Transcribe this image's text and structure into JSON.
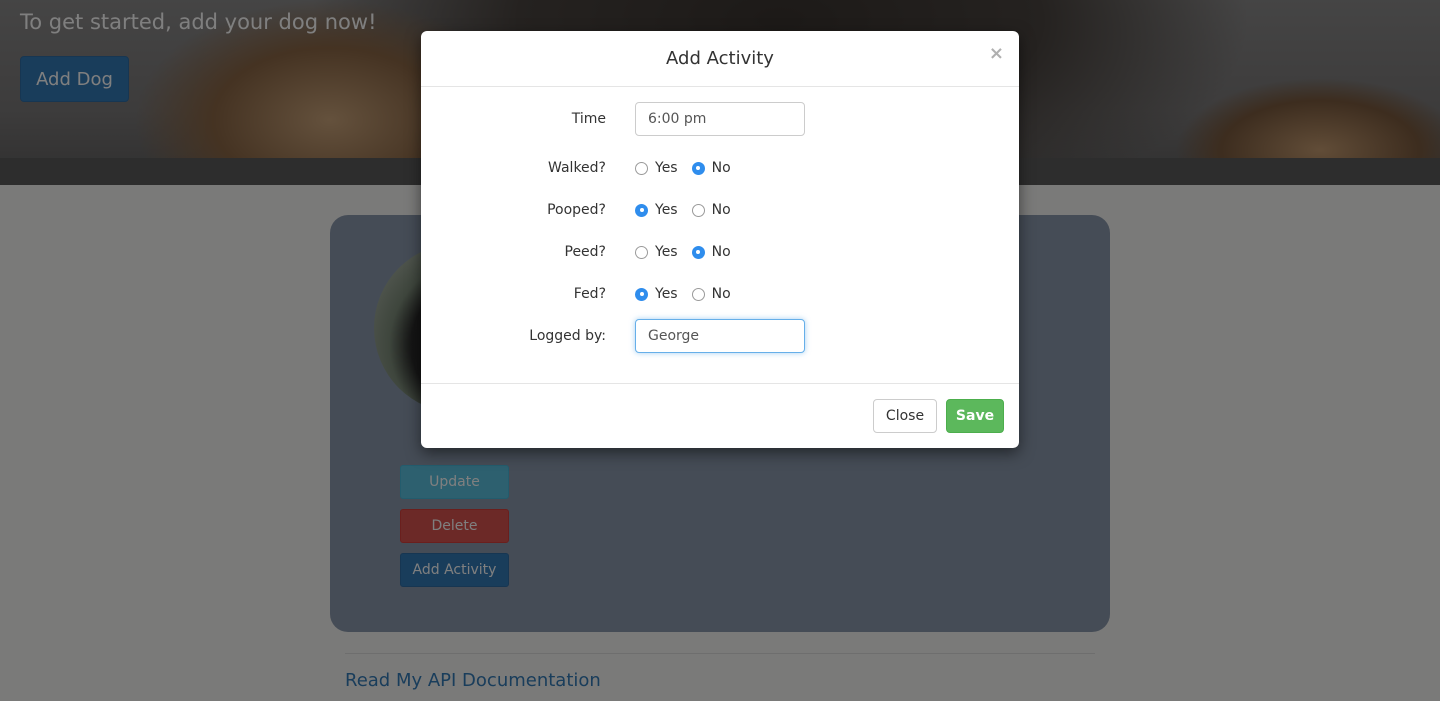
{
  "hero": {
    "text": "To get started, add your dog now!",
    "add_dog_label": "Add Dog"
  },
  "card": {
    "update_label": "Update",
    "delete_label": "Delete",
    "add_activity_label": "Add Activity"
  },
  "footer": {
    "api_link": "Read My API Documentation"
  },
  "modal": {
    "title": "Add Activity",
    "close_x": "×",
    "time_label": "Time",
    "time_value": "6:00 pm",
    "walked_label": "Walked?",
    "pooped_label": "Pooped?",
    "peed_label": "Peed?",
    "fed_label": "Fed?",
    "logged_by_label": "Logged by:",
    "logged_by_value": "George",
    "yes_label": "Yes",
    "no_label": "No",
    "close_button": "Close",
    "save_button": "Save",
    "selections": {
      "walked": "No",
      "pooped": "Yes",
      "peed": "No",
      "fed": "Yes"
    }
  },
  "colors": {
    "primary": "#337ab7",
    "info": "#5bc0de",
    "danger": "#d9534f",
    "success": "#5cb85c",
    "radio_checked": "#2f8ded"
  }
}
